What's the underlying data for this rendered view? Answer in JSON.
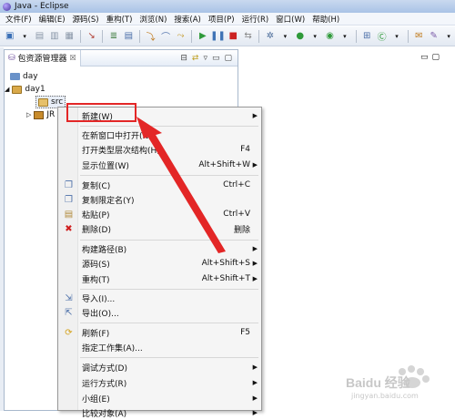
{
  "window": {
    "title": "Java - Eclipse"
  },
  "menubar": [
    "文件(F)",
    "编辑(E)",
    "源码(S)",
    "重构(T)",
    "浏览(N)",
    "搜索(A)",
    "项目(P)",
    "运行(R)",
    "窗口(W)",
    "帮助(H)"
  ],
  "toolbar_icons": [
    "new-icon",
    "save-icon",
    "print-icon",
    "debug-icon",
    "run-icon",
    "search-icon",
    "perspective-icon"
  ],
  "panel": {
    "tab_label": "包资源管理器",
    "tab_close": "☒",
    "tree": [
      {
        "label": "day"
      },
      {
        "label": "day1"
      },
      {
        "label": "src"
      },
      {
        "label": "JR"
      }
    ]
  },
  "context_menu": {
    "items": [
      {
        "label": "新建(W)",
        "shortcut": "",
        "submenu": true,
        "icon": ""
      },
      {
        "label": "在新窗口中打开(N)",
        "shortcut": "",
        "submenu": false,
        "icon": ""
      },
      {
        "label": "打开类型层次结构(H)",
        "shortcut": "F4",
        "submenu": false,
        "icon": ""
      },
      {
        "label": "显示位置(W)",
        "shortcut": "Alt+Shift+W",
        "submenu": true,
        "icon": ""
      },
      {
        "label": "复制(C)",
        "shortcut": "Ctrl+C",
        "submenu": false,
        "icon": "copy-icon"
      },
      {
        "label": "复制限定名(Y)",
        "shortcut": "",
        "submenu": false,
        "icon": "copy-icon"
      },
      {
        "label": "粘贴(P)",
        "shortcut": "Ctrl+V",
        "submenu": false,
        "icon": "paste-icon"
      },
      {
        "label": "删除(D)",
        "shortcut": "删除",
        "submenu": false,
        "icon": "delete-icon"
      },
      {
        "label": "构建路径(B)",
        "shortcut": "",
        "submenu": true,
        "icon": ""
      },
      {
        "label": "源码(S)",
        "shortcut": "Alt+Shift+S",
        "submenu": true,
        "icon": ""
      },
      {
        "label": "重构(T)",
        "shortcut": "Alt+Shift+T",
        "submenu": true,
        "icon": ""
      },
      {
        "label": "导入(I)...",
        "shortcut": "",
        "submenu": false,
        "icon": "import-icon"
      },
      {
        "label": "导出(O)...",
        "shortcut": "",
        "submenu": false,
        "icon": "export-icon"
      },
      {
        "label": "刷新(F)",
        "shortcut": "F5",
        "submenu": false,
        "icon": "refresh-icon"
      },
      {
        "label": "指定工作集(A)...",
        "shortcut": "",
        "submenu": false,
        "icon": ""
      },
      {
        "label": "调试方式(D)",
        "shortcut": "",
        "submenu": true,
        "icon": ""
      },
      {
        "label": "运行方式(R)",
        "shortcut": "",
        "submenu": true,
        "icon": ""
      },
      {
        "label": "小组(E)",
        "shortcut": "",
        "submenu": true,
        "icon": ""
      },
      {
        "label": "比较对象(A)",
        "shortcut": "",
        "submenu": true,
        "icon": ""
      }
    ]
  },
  "watermark": {
    "brand": "Baidu 经验",
    "url": "jingyan.baidu.com"
  },
  "colors": {
    "annotation": "#e32626",
    "menu_bg": "#f5f5f5",
    "titlebar": "#b7cdea"
  }
}
